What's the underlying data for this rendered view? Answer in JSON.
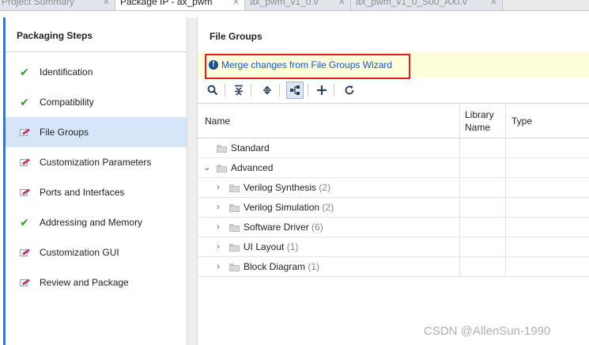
{
  "tabs": [
    {
      "label": "Project Summary",
      "active": false
    },
    {
      "label": "Package IP - ax_pwm",
      "active": true
    },
    {
      "label": "ax_pwm_v1_0.v",
      "active": false
    },
    {
      "label": "ax_pwm_v1_0_S00_AXI.v",
      "active": false
    }
  ],
  "left_panel": {
    "title": "Packaging Steps",
    "steps": [
      {
        "label": "Identification",
        "icon": "check-icon",
        "selected": false
      },
      {
        "label": "Compatibility",
        "icon": "check-icon",
        "selected": false
      },
      {
        "label": "File Groups",
        "icon": "edit-icon",
        "selected": true
      },
      {
        "label": "Customization Parameters",
        "icon": "edit-icon",
        "selected": false
      },
      {
        "label": "Ports and Interfaces",
        "icon": "edit-icon",
        "selected": false
      },
      {
        "label": "Addressing and Memory",
        "icon": "check-icon",
        "selected": false
      },
      {
        "label": "Customization GUI",
        "icon": "edit-icon",
        "selected": false
      },
      {
        "label": "Review and Package",
        "icon": "edit-icon",
        "selected": false
      }
    ]
  },
  "main": {
    "title": "File Groups",
    "banner": {
      "icon": "info-icon",
      "link": "Merge changes from File Groups Wizard"
    },
    "toolbar": [
      {
        "name": "search-icon",
        "glyph": "⚲"
      },
      {
        "name": "collapse-all-icon",
        "glyph": "⇞"
      },
      {
        "name": "expand-all-icon",
        "glyph": "⇕"
      },
      {
        "name": "hierarchy-icon",
        "glyph": "⊶"
      },
      {
        "name": "add-icon",
        "glyph": "+"
      },
      {
        "name": "refresh-icon",
        "glyph": "↻"
      }
    ],
    "table": {
      "columns": [
        "Name",
        "Library\nName",
        "Type"
      ],
      "rows": [
        {
          "name": "Standard",
          "count": "",
          "level": 0,
          "expander": ""
        },
        {
          "name": "Advanced",
          "count": "",
          "level": 0,
          "expander": "v"
        },
        {
          "name": "Verilog Synthesis",
          "count": "(2)",
          "level": 1,
          "expander": ">"
        },
        {
          "name": "Verilog Simulation",
          "count": "(2)",
          "level": 1,
          "expander": ">"
        },
        {
          "name": "Software Driver",
          "count": "(6)",
          "level": 1,
          "expander": ">"
        },
        {
          "name": "UI Layout",
          "count": "(1)",
          "level": 1,
          "expander": ">"
        },
        {
          "name": "Block Diagram",
          "count": "(1)",
          "level": 1,
          "expander": ">"
        }
      ]
    }
  },
  "watermark": "CSDN @AllenSun-1990",
  "colors": {
    "accent": "#3b73c5",
    "selected_row": "#d6e6f8",
    "banner_bg": "#fdfdd9",
    "link": "#1a56c5",
    "highlight_box": "#e02020",
    "check": "#2aa02a"
  }
}
